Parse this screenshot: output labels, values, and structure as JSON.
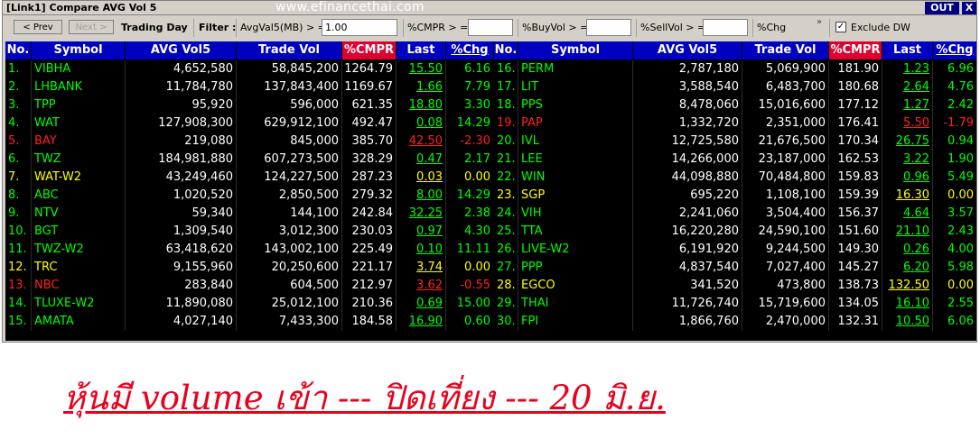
{
  "window": {
    "title": "[Link1] Compare AVG Vol 5",
    "watermark": "www.efinancethai.com",
    "out_label": "OUT",
    "close_label": "X"
  },
  "toolbar": {
    "prev_label": "< Prev",
    "next_label": "Next >",
    "trading_day_label": "Trading Day",
    "filter_label": "Filter :",
    "avgvol_label": "AvgVal5(MB) > =",
    "avgvol_value": "1.00",
    "cmpr_label": "%CMPR > =",
    "cmpr_value": "",
    "buyvol_label": "%BuyVol > =",
    "buyvol_value": "",
    "sellvol_label": "%SellVol > =",
    "sellvol_value": "",
    "chg_label": "%Chg",
    "more_label": "»",
    "exclude_dw_label": "Exclude DW",
    "exclude_dw_checked": "✓"
  },
  "headers": [
    "No.",
    "Symbol",
    "AVG Vol5",
    "Trade Vol",
    "%CMPR",
    "Last",
    "%Chg"
  ],
  "colors": {
    "green": "#00ff00",
    "red": "#ff2020",
    "yellow": "#ffff00",
    "header_bg": "#0000c0",
    "header_red": "#e00030"
  },
  "left_rows": [
    {
      "no": "1.",
      "symbol": "VIBHA",
      "avg": "4,652,580",
      "trade": "58,845,200",
      "cmpr": "1264.79",
      "last": "15.50",
      "chg": "6.16",
      "color": "green"
    },
    {
      "no": "2.",
      "symbol": "LHBANK",
      "avg": "11,784,780",
      "trade": "137,843,400",
      "cmpr": "1169.67",
      "last": "1.66",
      "chg": "7.79",
      "color": "green"
    },
    {
      "no": "3.",
      "symbol": "TPP",
      "avg": "95,920",
      "trade": "596,000",
      "cmpr": "621.35",
      "last": "18.80",
      "chg": "3.30",
      "color": "green"
    },
    {
      "no": "4.",
      "symbol": "WAT",
      "avg": "127,908,300",
      "trade": "629,912,100",
      "cmpr": "492.47",
      "last": "0.08",
      "chg": "14.29",
      "color": "green"
    },
    {
      "no": "5.",
      "symbol": "BAY",
      "avg": "219,080",
      "trade": "845,000",
      "cmpr": "385.70",
      "last": "42.50",
      "chg": "-2.30",
      "color": "red"
    },
    {
      "no": "6.",
      "symbol": "TWZ",
      "avg": "184,981,880",
      "trade": "607,273,500",
      "cmpr": "328.29",
      "last": "0.47",
      "chg": "2.17",
      "color": "green"
    },
    {
      "no": "7.",
      "symbol": "WAT-W2",
      "avg": "43,249,460",
      "trade": "124,227,500",
      "cmpr": "287.23",
      "last": "0.03",
      "chg": "0.00",
      "color": "yellow"
    },
    {
      "no": "8.",
      "symbol": "ABC",
      "avg": "1,020,520",
      "trade": "2,850,500",
      "cmpr": "279.32",
      "last": "8.00",
      "chg": "14.29",
      "color": "green"
    },
    {
      "no": "9.",
      "symbol": "NTV",
      "avg": "59,340",
      "trade": "144,100",
      "cmpr": "242.84",
      "last": "32.25",
      "chg": "2.38",
      "color": "green"
    },
    {
      "no": "10.",
      "symbol": "BGT",
      "avg": "1,309,540",
      "trade": "3,012,300",
      "cmpr": "230.03",
      "last": "0.97",
      "chg": "4.30",
      "color": "green"
    },
    {
      "no": "11.",
      "symbol": "TWZ-W2",
      "avg": "63,418,620",
      "trade": "143,002,100",
      "cmpr": "225.49",
      "last": "0.10",
      "chg": "11.11",
      "color": "green"
    },
    {
      "no": "12.",
      "symbol": "TRC",
      "avg": "9,155,960",
      "trade": "20,250,600",
      "cmpr": "221.17",
      "last": "3.74",
      "chg": "0.00",
      "color": "yellow"
    },
    {
      "no": "13.",
      "symbol": "NBC",
      "avg": "283,840",
      "trade": "604,500",
      "cmpr": "212.97",
      "last": "3.62",
      "chg": "-0.55",
      "color": "red"
    },
    {
      "no": "14.",
      "symbol": "TLUXE-W2",
      "avg": "11,890,080",
      "trade": "25,012,100",
      "cmpr": "210.36",
      "last": "0.69",
      "chg": "15.00",
      "color": "green"
    },
    {
      "no": "15.",
      "symbol": "AMATA",
      "avg": "4,027,140",
      "trade": "7,433,300",
      "cmpr": "184.58",
      "last": "16.90",
      "chg": "0.60",
      "color": "green"
    }
  ],
  "right_rows": [
    {
      "no": "16.",
      "symbol": "PERM",
      "avg": "2,787,180",
      "trade": "5,069,900",
      "cmpr": "181.90",
      "last": "1.23",
      "chg": "6.96",
      "color": "green"
    },
    {
      "no": "17.",
      "symbol": "LIT",
      "avg": "3,588,540",
      "trade": "6,483,700",
      "cmpr": "180.68",
      "last": "2.64",
      "chg": "4.76",
      "color": "green"
    },
    {
      "no": "18.",
      "symbol": "PPS",
      "avg": "8,478,060",
      "trade": "15,016,600",
      "cmpr": "177.12",
      "last": "1.27",
      "chg": "2.42",
      "color": "green"
    },
    {
      "no": "19.",
      "symbol": "PAP",
      "avg": "1,332,720",
      "trade": "2,351,000",
      "cmpr": "176.41",
      "last": "5.50",
      "chg": "-1.79",
      "color": "red"
    },
    {
      "no": "20.",
      "symbol": "IVL",
      "avg": "12,725,580",
      "trade": "21,676,500",
      "cmpr": "170.34",
      "last": "26.75",
      "chg": "0.94",
      "color": "green"
    },
    {
      "no": "21.",
      "symbol": "LEE",
      "avg": "14,266,000",
      "trade": "23,187,000",
      "cmpr": "162.53",
      "last": "3.22",
      "chg": "1.90",
      "color": "green"
    },
    {
      "no": "22.",
      "symbol": "WIN",
      "avg": "44,098,880",
      "trade": "70,484,800",
      "cmpr": "159.83",
      "last": "0.96",
      "chg": "5.49",
      "color": "green"
    },
    {
      "no": "23.",
      "symbol": "SGP",
      "avg": "695,220",
      "trade": "1,108,100",
      "cmpr": "159.39",
      "last": "16.30",
      "chg": "0.00",
      "color": "yellow"
    },
    {
      "no": "24.",
      "symbol": "VIH",
      "avg": "2,241,060",
      "trade": "3,504,400",
      "cmpr": "156.37",
      "last": "4.64",
      "chg": "3.57",
      "color": "green"
    },
    {
      "no": "25.",
      "symbol": "TTA",
      "avg": "16,220,280",
      "trade": "24,590,100",
      "cmpr": "151.60",
      "last": "21.10",
      "chg": "2.43",
      "color": "green"
    },
    {
      "no": "26.",
      "symbol": "LIVE-W2",
      "avg": "6,191,920",
      "trade": "9,244,500",
      "cmpr": "149.30",
      "last": "0.26",
      "chg": "4.00",
      "color": "green"
    },
    {
      "no": "27.",
      "symbol": "PPP",
      "avg": "4,837,540",
      "trade": "7,027,400",
      "cmpr": "145.27",
      "last": "6.20",
      "chg": "5.98",
      "color": "green"
    },
    {
      "no": "28.",
      "symbol": "EGCO",
      "avg": "341,520",
      "trade": "473,800",
      "cmpr": "138.73",
      "last": "132.50",
      "chg": "0.00",
      "color": "yellow"
    },
    {
      "no": "29.",
      "symbol": "THAI",
      "avg": "11,726,740",
      "trade": "15,719,600",
      "cmpr": "134.05",
      "last": "16.10",
      "chg": "2.55",
      "color": "green"
    },
    {
      "no": "30.",
      "symbol": "FPI",
      "avg": "1,866,760",
      "trade": "2,470,000",
      "cmpr": "132.31",
      "last": "10.50",
      "chg": "6.06",
      "color": "green"
    }
  ],
  "caption": "หุ้นมี volume เข้า --- ปิดเที่ยง --- 20 มิ.ย."
}
